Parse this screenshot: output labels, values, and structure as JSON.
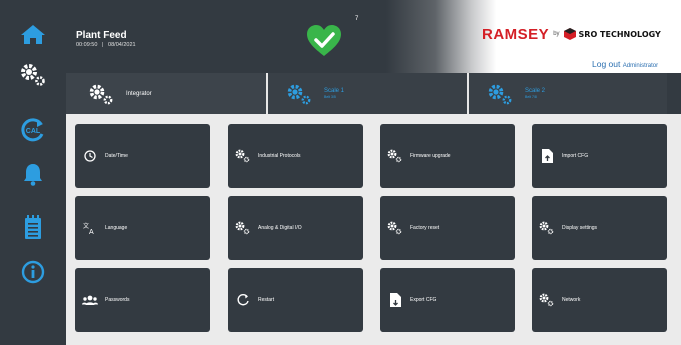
{
  "header": {
    "title": "Plant Feed",
    "time": "00:09:50",
    "separator": "|",
    "date": "08/04/2021",
    "alarm_count": "7",
    "logo_main": "RAMSEY",
    "logo_by": "by",
    "logo_partner": "SRO TECHNOLOGY",
    "logout_label": "Log out",
    "user": "Administrator"
  },
  "tabs": [
    {
      "label": "Integrator",
      "sub": ""
    },
    {
      "label": "Scale 1",
      "sub": "Belt 3/5"
    },
    {
      "label": "Scale 2",
      "sub": "Belt 7/8"
    }
  ],
  "tiles": [
    {
      "label": "Date/Time",
      "icon": "clock-icon"
    },
    {
      "label": "Industrial Protocols",
      "icon": "gears-icon"
    },
    {
      "label": "Firmware upgrade",
      "icon": "gears-icon"
    },
    {
      "label": "Import CFG",
      "icon": "file-import-icon"
    },
    {
      "label": "Language",
      "icon": "language-icon"
    },
    {
      "label": "Analog & Digital I/O",
      "icon": "gears-icon"
    },
    {
      "label": "Factory reset",
      "icon": "gears-icon"
    },
    {
      "label": "Display settings",
      "icon": "gears-icon"
    },
    {
      "label": "Passwords",
      "icon": "users-icon"
    },
    {
      "label": "Restart",
      "icon": "restart-icon"
    },
    {
      "label": "Export CFG",
      "icon": "file-export-icon"
    },
    {
      "label": "Network",
      "icon": "gears-icon"
    }
  ],
  "sidebar": {
    "items": [
      {
        "icon": "home-icon"
      },
      {
        "icon": "gears-icon"
      },
      {
        "icon": "calibration-icon",
        "label": "CAL"
      },
      {
        "icon": "bell-icon"
      },
      {
        "icon": "notepad-icon"
      },
      {
        "icon": "info-icon"
      }
    ]
  },
  "colors": {
    "panel": "#333a41",
    "accent": "#2d9de0",
    "health_ok": "#39b54a",
    "brand_red": "#d41f26",
    "link": "#2b6fb0"
  }
}
